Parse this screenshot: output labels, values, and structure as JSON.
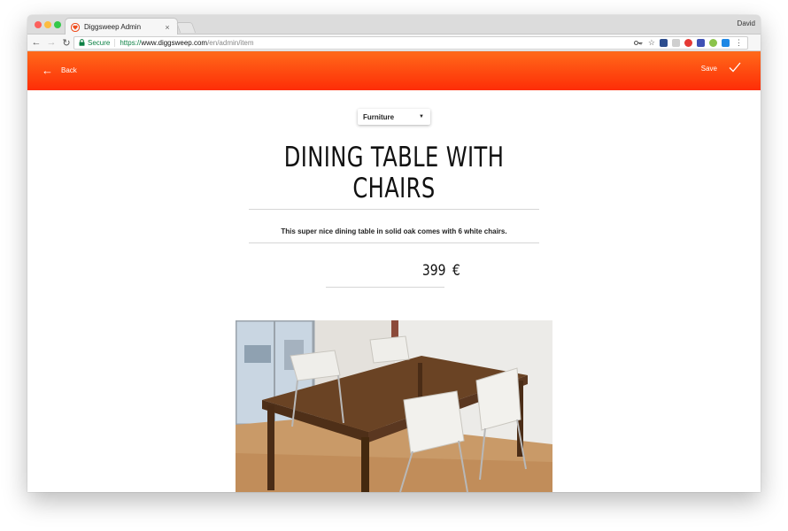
{
  "browser": {
    "tab_title": "Diggsweep Admin",
    "tab_close": "×",
    "profile_name": "David",
    "secure_label": "Secure",
    "url_scheme": "https://",
    "url_host": "www.diggsweep.com",
    "url_path": "/en/admin/item",
    "traffic_lights": [
      "#fc605c",
      "#fdbc40",
      "#34c84a"
    ],
    "extension_colors": [
      "#2d4d8e",
      "#cfcfcf",
      "#e53935",
      "#3f51b5",
      "#8bc34a",
      "#1e88e5"
    ]
  },
  "header": {
    "back_label": "Back",
    "save_label": "Save",
    "gradient_colors": [
      "#ff6a1a",
      "#fe2d07"
    ]
  },
  "item": {
    "category": "Furniture",
    "title": "DINING TABLE WITH CHAIRS",
    "description": "This super nice dining table in solid oak comes with 6 white chairs.",
    "price": "399",
    "currency": "€"
  }
}
